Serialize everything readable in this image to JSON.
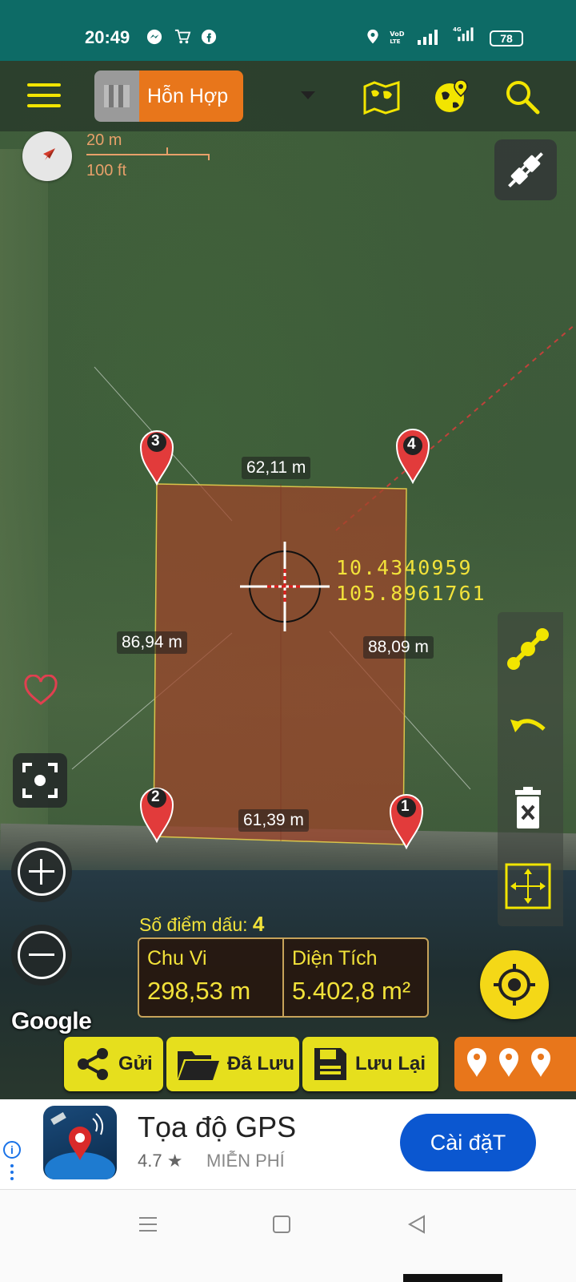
{
  "status_bar": {
    "time": "20:49",
    "battery": "78",
    "network": "4G",
    "volte": "VoLTE",
    "notification_icons": [
      "messenger-icon",
      "shopping-icon",
      "facebook-icon"
    ],
    "system_icons": [
      "location-icon",
      "volte-icon",
      "signal-icon",
      "4g-signal-icon",
      "battery-icon"
    ]
  },
  "toolbar": {
    "map_type_label": "Hỗn Hợp",
    "icons": [
      "menu-icon",
      "map-type-icon",
      "world-map-icon",
      "globe-pin-icon",
      "search-icon"
    ]
  },
  "map": {
    "scale_metric": "20 m",
    "scale_imperial": "100 ft",
    "edge_top": "62,11 m",
    "edge_left": "86,94 m",
    "edge_right": "88,09 m",
    "edge_bottom": "61,39 m",
    "latitude": "10.4340959",
    "longitude": "105.8961761",
    "markers": [
      "1",
      "2",
      "3",
      "4"
    ],
    "attribution": "Google",
    "polygon_color": "#a0442a",
    "accent_color": "#f2e23a"
  },
  "measure": {
    "points_label": "Số điểm dấu:",
    "points_count": "4",
    "perimeter_label": "Chu Vi",
    "perimeter_value": "298,53 m",
    "area_label": "Diện Tích",
    "area_value": "5.402,8 m²"
  },
  "actions": {
    "send_label": "Gửi",
    "saved_label": "Đã Lưu",
    "save_label": "Lưu Lại"
  },
  "ad": {
    "title": "Tọa độ GPS",
    "rating": "4.7 ★",
    "price": "MIỄN PHÍ",
    "install_label": "Cài đặT",
    "info_glyph": "i"
  }
}
